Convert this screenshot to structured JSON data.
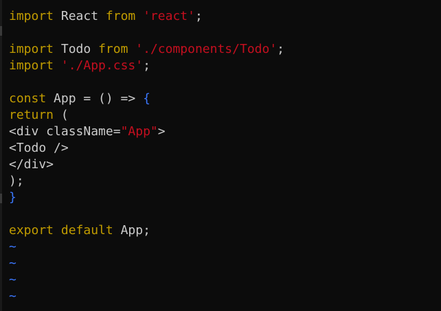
{
  "editor": {
    "lines": [
      [
        {
          "t": "import",
          "c": "kw"
        },
        {
          "t": " React ",
          "c": "txt"
        },
        {
          "t": "from",
          "c": "kw"
        },
        {
          "t": " ",
          "c": "txt"
        },
        {
          "t": "'react'",
          "c": "str"
        },
        {
          "t": ";",
          "c": "txt"
        }
      ],
      [],
      [
        {
          "t": "import",
          "c": "kw"
        },
        {
          "t": " Todo ",
          "c": "txt"
        },
        {
          "t": "from",
          "c": "kw"
        },
        {
          "t": " ",
          "c": "txt"
        },
        {
          "t": "'./components/Todo'",
          "c": "str"
        },
        {
          "t": ";",
          "c": "txt"
        }
      ],
      [
        {
          "t": "import",
          "c": "kw"
        },
        {
          "t": " ",
          "c": "txt"
        },
        {
          "t": "'./App.css'",
          "c": "str"
        },
        {
          "t": ";",
          "c": "txt"
        }
      ],
      [],
      [
        {
          "t": "const",
          "c": "kw"
        },
        {
          "t": " App = () => ",
          "c": "txt"
        },
        {
          "t": "{",
          "c": "br"
        }
      ],
      [
        {
          "t": "return",
          "c": "kw"
        },
        {
          "t": " (",
          "c": "txt"
        }
      ],
      [
        {
          "t": "<div className=",
          "c": "txt"
        },
        {
          "t": "\"App\"",
          "c": "str"
        },
        {
          "t": ">",
          "c": "txt"
        }
      ],
      [
        {
          "t": "<Todo />",
          "c": "txt"
        }
      ],
      [
        {
          "t": "</div>",
          "c": "txt"
        }
      ],
      [
        {
          "t": ");",
          "c": "txt"
        }
      ],
      [
        {
          "t": "}",
          "c": "br"
        }
      ],
      [],
      [
        {
          "t": "export",
          "c": "kw"
        },
        {
          "t": " ",
          "c": "txt"
        },
        {
          "t": "default",
          "c": "kw"
        },
        {
          "t": " App;",
          "c": "txt"
        }
      ],
      [
        {
          "t": "~",
          "c": "tilde"
        }
      ],
      [
        {
          "t": "~",
          "c": "tilde"
        }
      ],
      [
        {
          "t": "~",
          "c": "tilde"
        }
      ],
      [
        {
          "t": "~",
          "c": "tilde"
        }
      ]
    ]
  },
  "colors": {
    "background": "#0c0c0c",
    "keyword": "#c19c00",
    "string": "#c50f1f",
    "text": "#cccccc",
    "brace": "#3b78ff",
    "tilde": "#3b78ff"
  }
}
